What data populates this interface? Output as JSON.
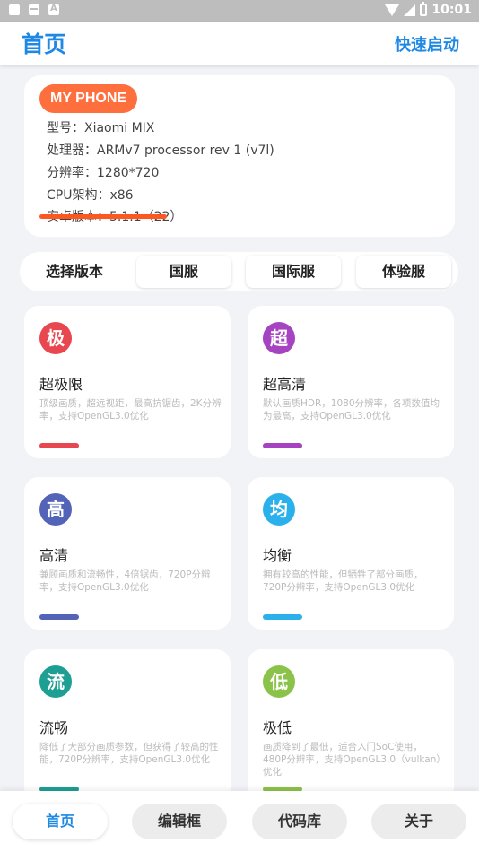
{
  "status_bar": {
    "time": "10:01",
    "left_icons": [
      "app-notification-icon",
      "message-notification-icon",
      "font-notification-icon"
    ],
    "right_icons": [
      "wifi-icon",
      "signal-icon",
      "battery-icon"
    ]
  },
  "app_bar": {
    "title": "首页",
    "action": "快速启动",
    "accent": "#1e88e5"
  },
  "phone_info": {
    "badge": "MY PHONE",
    "badge_color": "#ff6f3d",
    "lines": [
      "型号：Xiaomi MIX",
      "处理器：ARMv7 processor rev 1 (v7l)",
      "分辨率：1280*720",
      "CPU架构：x86",
      "安卓版本：5.1.1（22）"
    ]
  },
  "version_selector": {
    "label": "选择版本",
    "options": [
      "国服",
      "国际服",
      "体验服"
    ]
  },
  "modes": [
    {
      "icon_char": "极",
      "name": "超极限",
      "desc": "顶级画质，超远视距，最高抗锯齿，2K分辨率，支持OpenGL3.0优化",
      "color": "#e8474f"
    },
    {
      "icon_char": "超",
      "name": "超高清",
      "desc": "默认画质HDR，1080分辨率，各项数值均为最高，支持OpenGL3.0优化",
      "color": "#a643c0"
    },
    {
      "icon_char": "高",
      "name": "高清",
      "desc": "兼顾画质和流畅性，4倍锯齿，720P分辨率，支持OpenGL3.0优化",
      "color": "#5363b8"
    },
    {
      "icon_char": "均",
      "name": "均衡",
      "desc": "拥有较高的性能，但牺牲了部分画质，720P分辨率，支持OpenGL3.0优化",
      "color": "#2ab0ea"
    },
    {
      "icon_char": "流",
      "name": "流畅",
      "desc": "降低了大部分画质参数，但获得了较高的性能，720P分辨率，支持OpenGL3.0优化",
      "color": "#1e9f93"
    },
    {
      "icon_char": "低",
      "name": "极低",
      "desc": "画质降到了最低，适合入门SoC使用，480P分辨率，支持OpenGL3.0（vulkan）优化",
      "color": "#8bc34a"
    }
  ],
  "bottom_nav": {
    "items": [
      "首页",
      "编辑框",
      "代码库",
      "关于"
    ],
    "active_index": 0
  }
}
